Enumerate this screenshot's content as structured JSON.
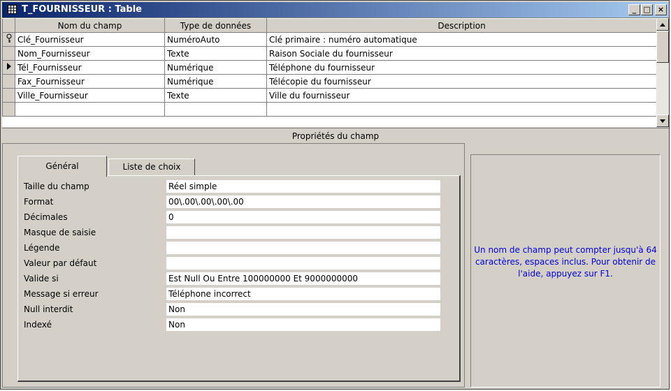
{
  "window": {
    "title": "T_FOURNISSEUR : Table"
  },
  "title_buttons": {
    "minimize": "_",
    "restore": "□",
    "close": "×"
  },
  "grid": {
    "columns": [
      "Nom du champ",
      "Type de données",
      "Description"
    ],
    "rows": [
      {
        "name": "Clé_Fournisseur",
        "type": "NuméroAuto",
        "description": "Clé primaire : numéro automatique",
        "selector": "key"
      },
      {
        "name": "Nom_Fournisseur",
        "type": "Texte",
        "description": "Raison Sociale du fournisseur",
        "selector": ""
      },
      {
        "name": "Tél_Fournisseur",
        "type": "Numérique",
        "description": "Téléphone du fournisseur",
        "selector": "current"
      },
      {
        "name": "Fax_Fournisseur",
        "type": "Numérique",
        "description": "Télécopie du fournisseur",
        "selector": ""
      },
      {
        "name": "Ville_Fournisseur",
        "type": "Texte",
        "description": "Ville du fournisseur",
        "selector": ""
      },
      {
        "name": "",
        "type": "",
        "description": "",
        "selector": ""
      }
    ]
  },
  "properties": {
    "header": "Propriétés du champ",
    "tabs": [
      "Général",
      "Liste de choix"
    ],
    "active_tab": "Général",
    "fields": [
      {
        "label": "Taille du champ",
        "value": "Réel simple"
      },
      {
        "label": "Format",
        "value": "00\\.00\\.00\\.00\\.00"
      },
      {
        "label": "Décimales",
        "value": "0"
      },
      {
        "label": "Masque de saisie",
        "value": ""
      },
      {
        "label": "Légende",
        "value": ""
      },
      {
        "label": "Valeur par défaut",
        "value": ""
      },
      {
        "label": "Valide si",
        "value": "Est Null Ou Entre 100000000 Et 9000000000"
      },
      {
        "label": "Message si erreur",
        "value": "Téléphone incorrect"
      },
      {
        "label": "Null interdit",
        "value": "Non"
      },
      {
        "label": "Indexé",
        "value": "Non"
      }
    ]
  },
  "help": {
    "text": "Un nom de champ peut compter jusqu'à 64 caractères, espaces inclus. Pour obtenir de l'aide, appuyez sur F1.",
    "color": "#0000e0"
  },
  "colors": {
    "titlebar_start": "#0a246a",
    "titlebar_end": "#a6caf0",
    "face": "#d4d0c8"
  }
}
